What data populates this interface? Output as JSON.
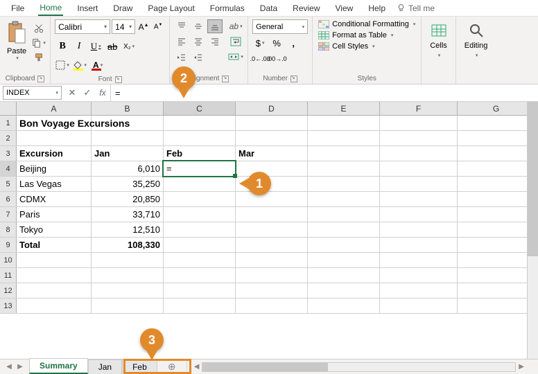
{
  "menu": {
    "items": [
      "File",
      "Home",
      "Insert",
      "Draw",
      "Page Layout",
      "Formulas",
      "Data",
      "Review",
      "View",
      "Help"
    ],
    "active": "Home",
    "tellme": "Tell me"
  },
  "ribbon": {
    "clipboard": {
      "paste": "Paste",
      "label": "Clipboard"
    },
    "font": {
      "name": "Calibri",
      "size": "14",
      "label": "Font"
    },
    "alignment": {
      "label": "Alignment"
    },
    "number": {
      "format": "General",
      "label": "Number"
    },
    "styles": {
      "conditional": "Conditional Formatting",
      "table": "Format as Table",
      "cell": "Cell Styles",
      "label": "Styles"
    },
    "cells": {
      "label": "Cells"
    },
    "editing": {
      "label": "Editing"
    }
  },
  "namebox": "INDEX",
  "formula": "=",
  "columns": [
    "A",
    "B",
    "C",
    "D",
    "E",
    "F",
    "G"
  ],
  "title_cell": "Bon Voyage Excursions",
  "headers": {
    "excursion": "Excursion",
    "jan": "Jan",
    "feb": "Feb",
    "mar": "Mar"
  },
  "rows": [
    {
      "name": "Beijing",
      "jan": "6,010"
    },
    {
      "name": "Las Vegas",
      "jan": "35,250"
    },
    {
      "name": "CDMX",
      "jan": "20,850"
    },
    {
      "name": "Paris",
      "jan": "33,710"
    },
    {
      "name": "Tokyo",
      "jan": "12,510"
    }
  ],
  "total": {
    "label": "Total",
    "jan": "108,330"
  },
  "active_cell_value": "=",
  "sheets": [
    "Summary",
    "Jan",
    "Feb"
  ],
  "active_sheet": "Summary",
  "callouts": {
    "c1": "1",
    "c2": "2",
    "c3": "3"
  }
}
